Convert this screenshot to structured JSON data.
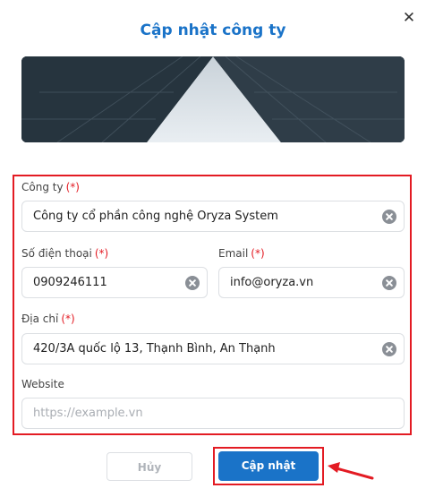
{
  "modal": {
    "title": "Cập nhật công ty",
    "close_label": "✕"
  },
  "form": {
    "company": {
      "label": "Công ty",
      "required": "(*)",
      "value": "Công ty cổ phần công nghệ Oryza System"
    },
    "phone": {
      "label": "Số điện thoại",
      "required": "(*)",
      "value": "0909246111"
    },
    "email": {
      "label": "Email",
      "required": "(*)",
      "value": "info@oryza.vn"
    },
    "address": {
      "label": "Địa chỉ",
      "required": "(*)",
      "value": "420/3A quốc lộ 13, Thạnh Bình, An Thạnh"
    },
    "website": {
      "label": "Website",
      "value": "",
      "placeholder": "https://example.vn"
    }
  },
  "footer": {
    "cancel_label": "Hủy",
    "submit_label": "Cập nhật"
  },
  "colors": {
    "accent": "#1a73c8",
    "highlight": "#e31b23"
  },
  "icons": {
    "close": "close-icon",
    "clear": "clear-icon",
    "annotation": "arrow-icon"
  }
}
